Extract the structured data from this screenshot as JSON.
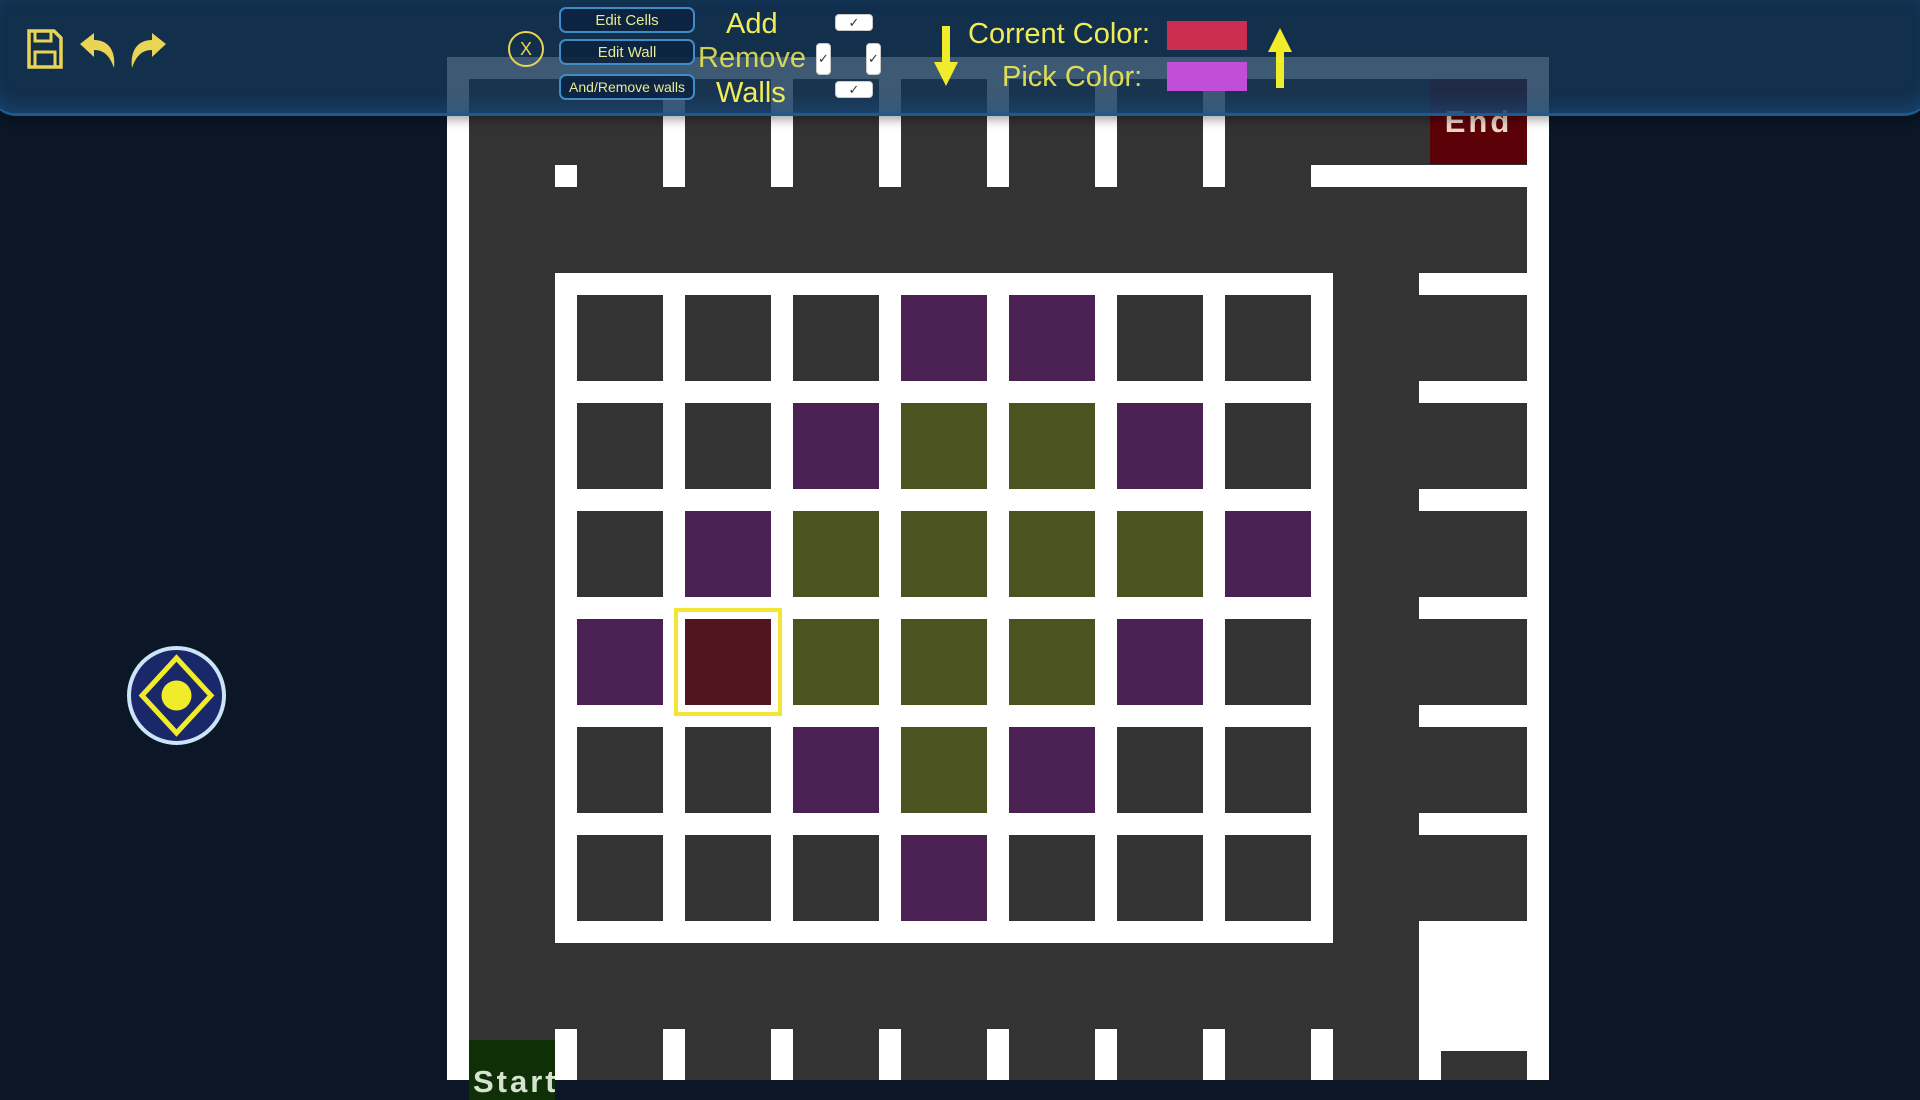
{
  "toolbar": {
    "save_icon": "save-icon",
    "undo_icon": "undo-icon",
    "redo_icon": "redo-icon",
    "close_label": "X",
    "edit_cells_label": "Edit Cells",
    "edit_wall_label": "Edit Wall",
    "add_remove_walls_label": "And/Remove walls",
    "add_label": "Add",
    "remove_label": "Remove",
    "walls_label": "Walls",
    "current_color_label": "Corrent Color:",
    "pick_color_label": "Pick Color:",
    "current_color": "#cc2d50",
    "pick_color": "#c24ed8",
    "arrow_down_icon": "arrow-down-icon",
    "arrow_up_icon": "arrow-up-icon"
  },
  "board": {
    "end_label": "End",
    "start_label": "Start",
    "colors": {
      "empty": "#333333",
      "purple": "#4b2153",
      "olive": "#4b5320",
      "dark_red": "#521520",
      "wall": "#ffffff",
      "selection": "#f2e535"
    },
    "grid": [
      [
        "empty",
        "empty",
        "empty",
        "purple",
        "purple",
        "empty",
        "empty"
      ],
      [
        "empty",
        "empty",
        "purple",
        "olive",
        "olive",
        "purple",
        "empty"
      ],
      [
        "empty",
        "purple",
        "olive",
        "olive",
        "olive",
        "olive",
        "purple"
      ],
      [
        "purple",
        "dark_red",
        "olive",
        "olive",
        "olive",
        "purple",
        "empty"
      ],
      [
        "empty",
        "empty",
        "purple",
        "olive",
        "purple",
        "empty",
        "empty"
      ],
      [
        "empty",
        "empty",
        "empty",
        "purple",
        "empty",
        "empty",
        "empty"
      ]
    ],
    "selected_cell": {
      "row": 3,
      "col": 1
    }
  },
  "joystick": {
    "icon": "move-joystick-icon"
  }
}
